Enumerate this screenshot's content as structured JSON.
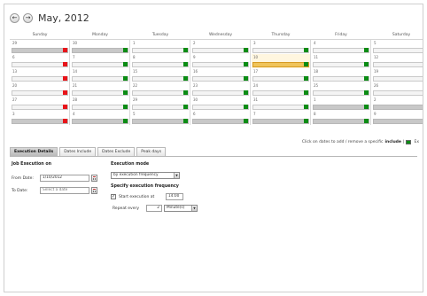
{
  "calendar": {
    "month_title": "May, 2012",
    "prev_label": "←",
    "next_label": "→",
    "weekdays": [
      "Sunday",
      "Monday",
      "Tuesday",
      "Wednesday",
      "Thursday",
      "Friday",
      "Saturday"
    ],
    "weeks": [
      [
        {
          "day": "29",
          "state": "grey",
          "mark": "red"
        },
        {
          "day": "30",
          "state": "grey",
          "mark": "green"
        },
        {
          "day": "1",
          "state": "normal",
          "mark": "green"
        },
        {
          "day": "2",
          "state": "normal",
          "mark": "green"
        },
        {
          "day": "3",
          "state": "normal",
          "mark": "green"
        },
        {
          "day": "4",
          "state": "normal",
          "mark": "green"
        },
        {
          "day": "5",
          "state": "normal",
          "mark": "red"
        }
      ],
      [
        {
          "day": "6",
          "state": "normal",
          "mark": "red"
        },
        {
          "day": "7",
          "state": "normal",
          "mark": "green"
        },
        {
          "day": "8",
          "state": "normal",
          "mark": "green"
        },
        {
          "day": "9",
          "state": "normal",
          "mark": "green"
        },
        {
          "day": "10",
          "state": "today",
          "mark": "green"
        },
        {
          "day": "11",
          "state": "normal",
          "mark": "green"
        },
        {
          "day": "12",
          "state": "normal",
          "mark": "red"
        }
      ],
      [
        {
          "day": "13",
          "state": "normal",
          "mark": "red"
        },
        {
          "day": "14",
          "state": "normal",
          "mark": "green"
        },
        {
          "day": "15",
          "state": "normal",
          "mark": "green"
        },
        {
          "day": "16",
          "state": "normal",
          "mark": "green"
        },
        {
          "day": "17",
          "state": "normal",
          "mark": "green"
        },
        {
          "day": "18",
          "state": "normal",
          "mark": "green"
        },
        {
          "day": "19",
          "state": "normal",
          "mark": "red"
        }
      ],
      [
        {
          "day": "20",
          "state": "normal",
          "mark": "red"
        },
        {
          "day": "21",
          "state": "normal",
          "mark": "green"
        },
        {
          "day": "22",
          "state": "normal",
          "mark": "green"
        },
        {
          "day": "23",
          "state": "normal",
          "mark": "green"
        },
        {
          "day": "24",
          "state": "normal",
          "mark": "green"
        },
        {
          "day": "25",
          "state": "normal",
          "mark": "green"
        },
        {
          "day": "26",
          "state": "normal",
          "mark": "red"
        }
      ],
      [
        {
          "day": "27",
          "state": "normal",
          "mark": "red"
        },
        {
          "day": "28",
          "state": "normal",
          "mark": "green"
        },
        {
          "day": "29",
          "state": "normal",
          "mark": "green"
        },
        {
          "day": "30",
          "state": "normal",
          "mark": "green"
        },
        {
          "day": "31",
          "state": "normal",
          "mark": "green"
        },
        {
          "day": "1",
          "state": "grey",
          "mark": "green"
        },
        {
          "day": "2",
          "state": "grey",
          "mark": "red"
        }
      ],
      [
        {
          "day": "3",
          "state": "grey",
          "mark": "red"
        },
        {
          "day": "4",
          "state": "grey",
          "mark": "green"
        },
        {
          "day": "5",
          "state": "grey",
          "mark": "green"
        },
        {
          "day": "6",
          "state": "grey",
          "mark": "green"
        },
        {
          "day": "7",
          "state": "grey",
          "mark": "green"
        },
        {
          "day": "8",
          "state": "grey",
          "mark": "green"
        },
        {
          "day": "9",
          "state": "grey",
          "mark": "red"
        }
      ]
    ]
  },
  "legend": {
    "text": "Click on dates to add / remove a specific",
    "bold": "include",
    "separator": "|",
    "trail": "Ex"
  },
  "tabs": [
    {
      "label": "Execution Details",
      "active": true
    },
    {
      "label": "Dates Include",
      "active": false
    },
    {
      "label": "Dates Exclude",
      "active": false
    },
    {
      "label": "Peak days",
      "active": false
    }
  ],
  "job_execution": {
    "title": "Job Execution on",
    "from_label": "From Date:",
    "from_value": "1/10/2012",
    "to_label": "To Date:",
    "to_placeholder": "Select a date"
  },
  "execution_mode": {
    "title": "Execution mode",
    "mode_value": "by execution frequency",
    "frequency_title": "Specify execution frequency",
    "start_label": "Start execution at",
    "start_checked": true,
    "start_value": "14:00",
    "repeat_label": "Repeat every",
    "repeat_value": "2",
    "repeat_unit": "Minute(s)"
  },
  "colors": {
    "green": "#0b8c14",
    "red": "#e8141a",
    "today": "#f0c45a"
  }
}
